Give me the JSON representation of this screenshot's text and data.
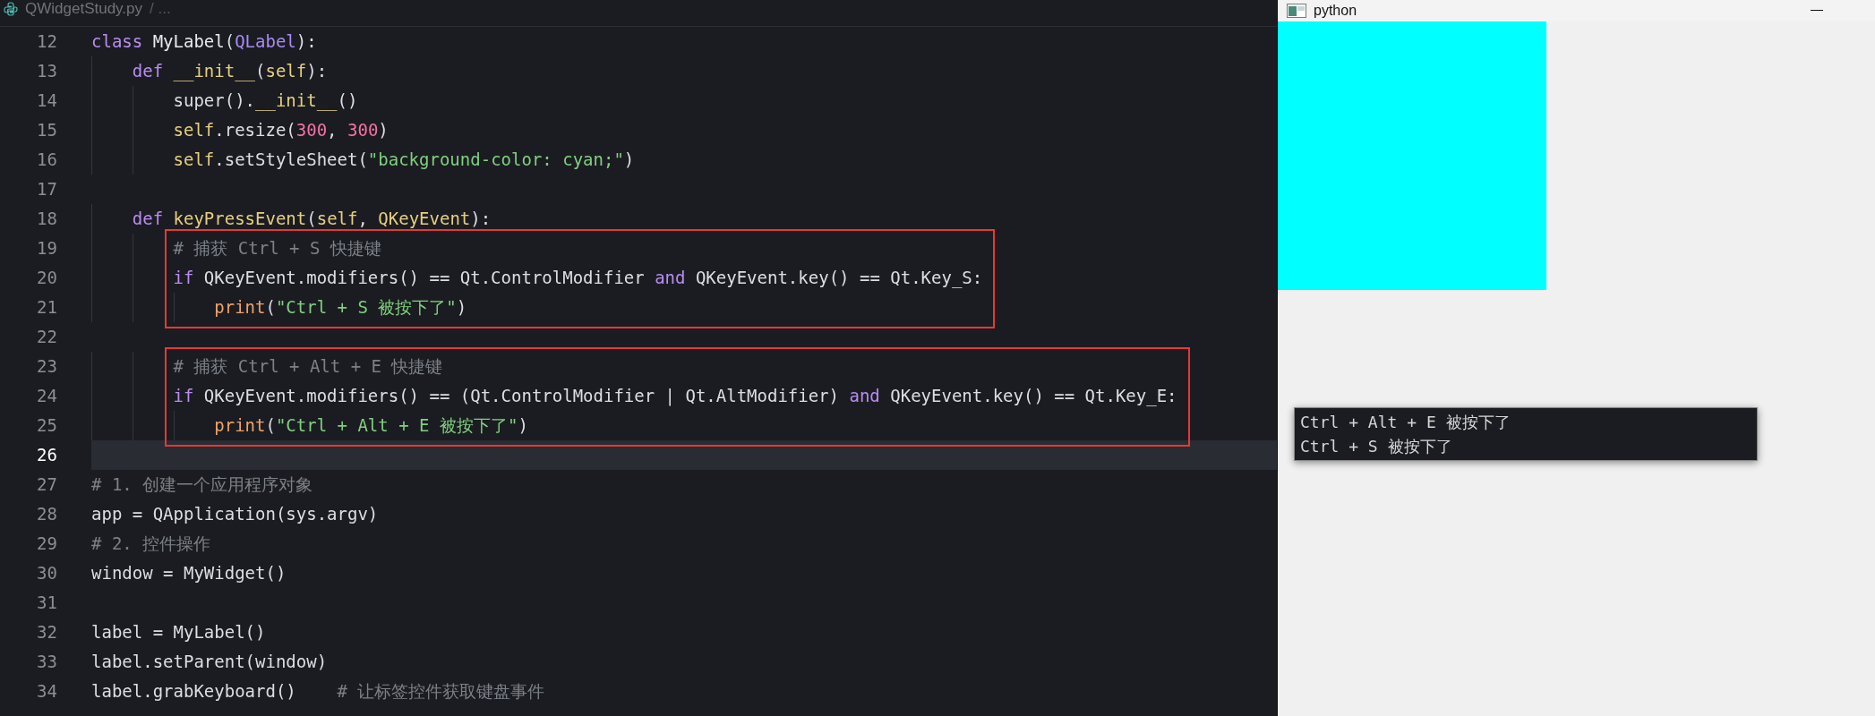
{
  "editor": {
    "breadcrumb": {
      "file": "QWidgetStudy.py",
      "rest": "/ ..."
    },
    "code": [
      {
        "kind": "line",
        "number": "12",
        "current": false,
        "tokens": [
          {
            "kind": "keyword",
            "text": "class "
          },
          {
            "kind": "classname",
            "text": "MyLabel"
          },
          {
            "kind": "plain",
            "text": "("
          },
          {
            "kind": "base",
            "text": "QLabel"
          },
          {
            "kind": "plain",
            "text": "):"
          }
        ]
      },
      {
        "kind": "line",
        "number": "13",
        "current": false,
        "tokens": [
          {
            "kind": "keyword",
            "text": "    def "
          },
          {
            "kind": "function",
            "text": "__init__"
          },
          {
            "kind": "plain",
            "text": "("
          },
          {
            "kind": "self",
            "text": "self"
          },
          {
            "kind": "plain",
            "text": "):"
          }
        ]
      },
      {
        "kind": "line",
        "number": "14",
        "current": false,
        "tokens": [
          {
            "kind": "plain",
            "text": "        super()."
          },
          {
            "kind": "function",
            "text": "__init__"
          },
          {
            "kind": "plain",
            "text": "()"
          }
        ]
      },
      {
        "kind": "line",
        "number": "15",
        "current": false,
        "tokens": [
          {
            "kind": "self",
            "text": "        self"
          },
          {
            "kind": "plain",
            "text": ".resize("
          },
          {
            "kind": "number",
            "text": "300"
          },
          {
            "kind": "plain",
            "text": ", "
          },
          {
            "kind": "number",
            "text": "300"
          },
          {
            "kind": "plain",
            "text": ")"
          }
        ]
      },
      {
        "kind": "line",
        "number": "16",
        "current": false,
        "tokens": [
          {
            "kind": "self",
            "text": "        self"
          },
          {
            "kind": "plain",
            "text": ".setStyleSheet("
          },
          {
            "kind": "string",
            "text": "\"background-color: cyan;\""
          },
          {
            "kind": "plain",
            "text": ")"
          }
        ]
      },
      {
        "kind": "line",
        "number": "17",
        "current": false
      },
      {
        "kind": "line",
        "number": "18",
        "current": false,
        "tokens": [
          {
            "kind": "keyword",
            "text": "    def "
          },
          {
            "kind": "function",
            "text": "keyPressEvent"
          },
          {
            "kind": "plain",
            "text": "("
          },
          {
            "kind": "self",
            "text": "self"
          },
          {
            "kind": "plain",
            "text": ", "
          },
          {
            "kind": "self",
            "text": "QKeyEvent"
          },
          {
            "kind": "plain",
            "text": "):"
          }
        ]
      },
      {
        "kind": "box",
        "lines": [
          {
            "number": "19",
            "current": false,
            "tokens": [
              {
                "kind": "comment",
                "text": "        # 捕获 Ctrl + S 快捷键"
              }
            ]
          },
          {
            "number": "20",
            "current": false,
            "tokens": [
              {
                "kind": "keyword",
                "text": "        if"
              },
              {
                "kind": "plain",
                "text": " QKeyEvent.modifiers() == Qt.ControlModifier "
              },
              {
                "kind": "keyword",
                "text": "and"
              },
              {
                "kind": "plain",
                "text": " QKeyEvent.key() == Qt.Key_S:"
              }
            ]
          },
          {
            "number": "21",
            "current": false,
            "tokens": [
              {
                "kind": "print",
                "text": "            print"
              },
              {
                "kind": "plain",
                "text": "("
              },
              {
                "kind": "string",
                "text": "\"Ctrl + S 被按下了\""
              },
              {
                "kind": "plain",
                "text": ")"
              }
            ]
          }
        ]
      },
      {
        "kind": "line",
        "number": "22",
        "current": false
      },
      {
        "kind": "box",
        "lines": [
          {
            "number": "23",
            "current": false,
            "tokens": [
              {
                "kind": "comment",
                "text": "        # 捕获 Ctrl + Alt + E 快捷键"
              }
            ]
          },
          {
            "number": "24",
            "current": false,
            "tokens": [
              {
                "kind": "keyword",
                "text": "        if"
              },
              {
                "kind": "plain",
                "text": " QKeyEvent.modifiers() == (Qt.ControlModifier | Qt.AltModifier) "
              },
              {
                "kind": "keyword",
                "text": "and"
              },
              {
                "kind": "plain",
                "text": " QKeyEvent.key() == Qt.Key_E:"
              }
            ]
          },
          {
            "number": "25",
            "current": false,
            "tokens": [
              {
                "kind": "print",
                "text": "            print"
              },
              {
                "kind": "plain",
                "text": "("
              },
              {
                "kind": "string",
                "text": "\"Ctrl + Alt + E 被按下了\""
              },
              {
                "kind": "plain",
                "text": ")"
              }
            ]
          }
        ]
      },
      {
        "kind": "line",
        "number": "26",
        "current": true
      },
      {
        "kind": "line",
        "number": "27",
        "current": false,
        "tokens": [
          {
            "kind": "comment",
            "text": "# 1. 创建一个应用程序对象"
          }
        ]
      },
      {
        "kind": "line",
        "number": "28",
        "current": false,
        "tokens": [
          {
            "kind": "plain",
            "text": "app = QApplication(sys.argv)"
          }
        ]
      },
      {
        "kind": "line",
        "number": "29",
        "current": false,
        "tokens": [
          {
            "kind": "comment",
            "text": "# 2. 控件操作"
          }
        ]
      },
      {
        "kind": "line",
        "number": "30",
        "current": false,
        "tokens": [
          {
            "kind": "plain",
            "text": "window = MyWidget()"
          }
        ]
      },
      {
        "kind": "line",
        "number": "31",
        "current": false
      },
      {
        "kind": "line",
        "number": "32",
        "current": false,
        "tokens": [
          {
            "kind": "plain",
            "text": "label = MyLabel()"
          }
        ]
      },
      {
        "kind": "line",
        "number": "33",
        "current": false,
        "tokens": [
          {
            "kind": "plain",
            "text": "label.setParent(window)"
          }
        ]
      },
      {
        "kind": "line",
        "number": "34",
        "current": false,
        "tokens": [
          {
            "kind": "plain",
            "text": "label.grabKeyboard()    "
          },
          {
            "kind": "comment",
            "text": "# 让标签控件获取键盘事件"
          }
        ]
      }
    ]
  },
  "app_window": {
    "title": "python",
    "console": {
      "lines": [
        "Ctrl + Alt + E 被按下了",
        "Ctrl + S 被按下了"
      ]
    }
  }
}
